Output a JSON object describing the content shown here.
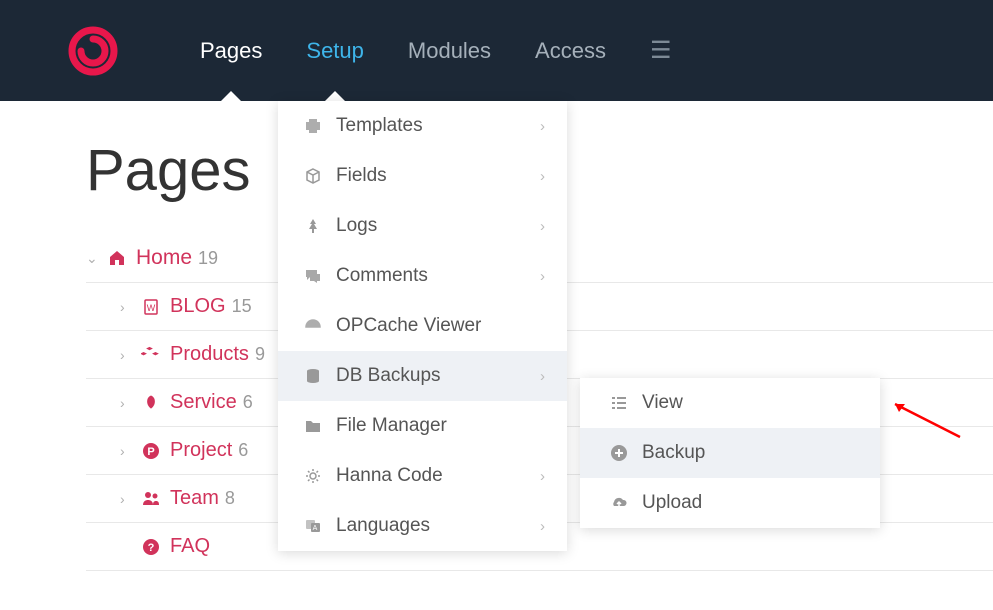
{
  "nav": {
    "pages": "Pages",
    "setup": "Setup",
    "modules": "Modules",
    "access": "Access"
  },
  "page_title": "Pages",
  "tree": {
    "home": {
      "label": "Home",
      "count": "19"
    },
    "blog": {
      "label": "BLOG",
      "count": "15"
    },
    "products": {
      "label": "Products",
      "count": "9"
    },
    "service": {
      "label": "Service",
      "count": "6"
    },
    "project": {
      "label": "Project",
      "count": "6"
    },
    "team": {
      "label": "Team",
      "count": "8"
    },
    "faq": {
      "label": "FAQ"
    }
  },
  "setup_menu": {
    "templates": "Templates",
    "fields": "Fields",
    "logs": "Logs",
    "comments": "Comments",
    "opcache": "OPCache Viewer",
    "dbbackups": "DB Backups",
    "filemanager": "File Manager",
    "hannacode": "Hanna Code",
    "languages": "Languages"
  },
  "dbbackups_submenu": {
    "view": "View",
    "backup": "Backup",
    "upload": "Upload"
  }
}
